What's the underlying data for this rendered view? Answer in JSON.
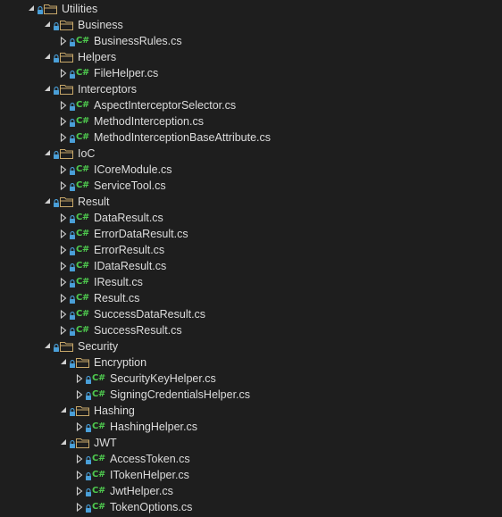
{
  "tree": [
    {
      "label": "Utilities",
      "kind": "folder",
      "depth": 0,
      "expanded": true
    },
    {
      "label": "Business",
      "kind": "folder",
      "depth": 1,
      "expanded": true
    },
    {
      "label": "BusinessRules.cs",
      "kind": "cs",
      "depth": 2,
      "expanded": false
    },
    {
      "label": "Helpers",
      "kind": "folder",
      "depth": 1,
      "expanded": true
    },
    {
      "label": "FileHelper.cs",
      "kind": "cs",
      "depth": 2,
      "expanded": false
    },
    {
      "label": "Interceptors",
      "kind": "folder",
      "depth": 1,
      "expanded": true
    },
    {
      "label": "AspectInterceptorSelector.cs",
      "kind": "cs",
      "depth": 2,
      "expanded": false
    },
    {
      "label": "MethodInterception.cs",
      "kind": "cs",
      "depth": 2,
      "expanded": false
    },
    {
      "label": "MethodInterceptionBaseAttribute.cs",
      "kind": "cs",
      "depth": 2,
      "expanded": false
    },
    {
      "label": "IoC",
      "kind": "folder",
      "depth": 1,
      "expanded": true
    },
    {
      "label": "ICoreModule.cs",
      "kind": "cs",
      "depth": 2,
      "expanded": false
    },
    {
      "label": "ServiceTool.cs",
      "kind": "cs",
      "depth": 2,
      "expanded": false
    },
    {
      "label": "Result",
      "kind": "folder",
      "depth": 1,
      "expanded": true
    },
    {
      "label": "DataResult.cs",
      "kind": "cs",
      "depth": 2,
      "expanded": false
    },
    {
      "label": "ErrorDataResult.cs",
      "kind": "cs",
      "depth": 2,
      "expanded": false
    },
    {
      "label": "ErrorResult.cs",
      "kind": "cs",
      "depth": 2,
      "expanded": false
    },
    {
      "label": "IDataResult.cs",
      "kind": "cs",
      "depth": 2,
      "expanded": false
    },
    {
      "label": "IResult.cs",
      "kind": "cs",
      "depth": 2,
      "expanded": false
    },
    {
      "label": "Result.cs",
      "kind": "cs",
      "depth": 2,
      "expanded": false
    },
    {
      "label": "SuccessDataResult.cs",
      "kind": "cs",
      "depth": 2,
      "expanded": false
    },
    {
      "label": "SuccessResult.cs",
      "kind": "cs",
      "depth": 2,
      "expanded": false
    },
    {
      "label": "Security",
      "kind": "folder",
      "depth": 1,
      "expanded": true
    },
    {
      "label": "Encryption",
      "kind": "folder",
      "depth": 2,
      "expanded": true
    },
    {
      "label": "SecurityKeyHelper.cs",
      "kind": "cs",
      "depth": 3,
      "expanded": false
    },
    {
      "label": "SigningCredentialsHelper.cs",
      "kind": "cs",
      "depth": 3,
      "expanded": false
    },
    {
      "label": "Hashing",
      "kind": "folder",
      "depth": 2,
      "expanded": true
    },
    {
      "label": "HashingHelper.cs",
      "kind": "cs",
      "depth": 3,
      "expanded": false
    },
    {
      "label": "JWT",
      "kind": "folder",
      "depth": 2,
      "expanded": true
    },
    {
      "label": "AccessToken.cs",
      "kind": "cs",
      "depth": 3,
      "expanded": false
    },
    {
      "label": "ITokenHelper.cs",
      "kind": "cs",
      "depth": 3,
      "expanded": false
    },
    {
      "label": "JwtHelper.cs",
      "kind": "cs",
      "depth": 3,
      "expanded": false
    },
    {
      "label": "TokenOptions.cs",
      "kind": "cs",
      "depth": 3,
      "expanded": false
    }
  ],
  "icons": {
    "cs_glyph": "C#",
    "expanded_arrow": "expanded-arrow-icon",
    "collapsed_arrow": "collapsed-arrow-icon",
    "folder": "folder-icon",
    "lock": "lock-icon",
    "csharp_file": "csharp-file-icon"
  },
  "colors": {
    "background": "#1e1e1e",
    "text": "#dcdcdc",
    "cs_icon": "#4ec94e",
    "lock": "#4a9fd8",
    "folder": "#c8a86a",
    "arrow": "#d0d0d0"
  }
}
